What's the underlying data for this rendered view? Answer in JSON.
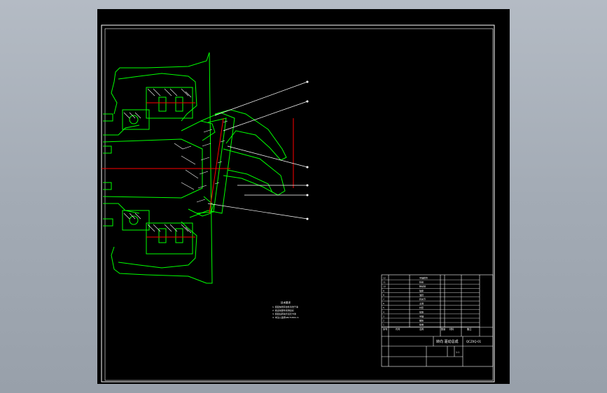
{
  "colors": {
    "background": "#a6aeb8",
    "canvas": "#000000",
    "frame": "#ffffff",
    "geometry": "#00ff00",
    "centerline": "#ff0000",
    "hatch": "#ffffff",
    "leader": "#ffffff"
  },
  "title_block": {
    "drawing_title": "转向 驱动总成",
    "drawing_number": "QCZXQ-01",
    "scale": "1:1"
  },
  "notes": {
    "heading": "技术要求",
    "lines": [
      "1. 装配前所有零件清洗干净",
      "2. 各运动部件润滑良好",
      "3. 装配后转动灵活无卡滞",
      "4. 未注公差按GB/T1804-m"
    ]
  },
  "parts_list": {
    "rows": [
      {
        "no": "12",
        "name": "半轴套管"
      },
      {
        "no": "11",
        "name": "轮毂"
      },
      {
        "no": "10",
        "name": "制动鼓"
      },
      {
        "no": "9",
        "name": "轴承"
      },
      {
        "no": "8",
        "name": "油封"
      },
      {
        "no": "7",
        "name": "转向节"
      },
      {
        "no": "6",
        "name": "主销"
      },
      {
        "no": "5",
        "name": "衬套"
      },
      {
        "no": "4",
        "name": "球笼"
      },
      {
        "no": "3",
        "name": "半轴"
      },
      {
        "no": "2",
        "name": "螺栓"
      },
      {
        "no": "1",
        "name": "垫圈"
      }
    ],
    "header": {
      "no": "序号",
      "code": "代号",
      "name": "名称",
      "qty": "数量",
      "material": "材料",
      "remark": "备注"
    }
  }
}
